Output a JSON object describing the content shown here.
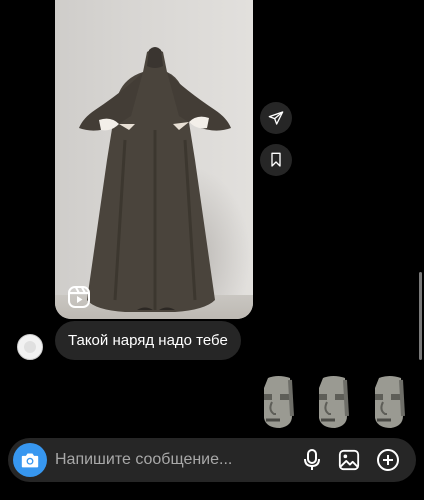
{
  "shared_reel": {
    "media": "reel-video-frame",
    "badge_icon": "reels-icon"
  },
  "side_actions": {
    "share_icon": "send-icon",
    "save_icon": "bookmark-icon"
  },
  "message": {
    "text": "Такой наряд надо тебе"
  },
  "stickers": [
    "moai-emoji",
    "moai-emoji",
    "moai-emoji"
  ],
  "composer": {
    "placeholder": "Напишите сообщение...",
    "camera_icon": "camera-icon",
    "mic_icon": "microphone-icon",
    "gallery_icon": "gallery-icon",
    "add_icon": "plus-circle-icon"
  },
  "colors": {
    "background": "#000000",
    "bubble": "#262626",
    "accent": "#3797f0",
    "text": "#ffffff",
    "placeholder": "#a8a8a8"
  }
}
